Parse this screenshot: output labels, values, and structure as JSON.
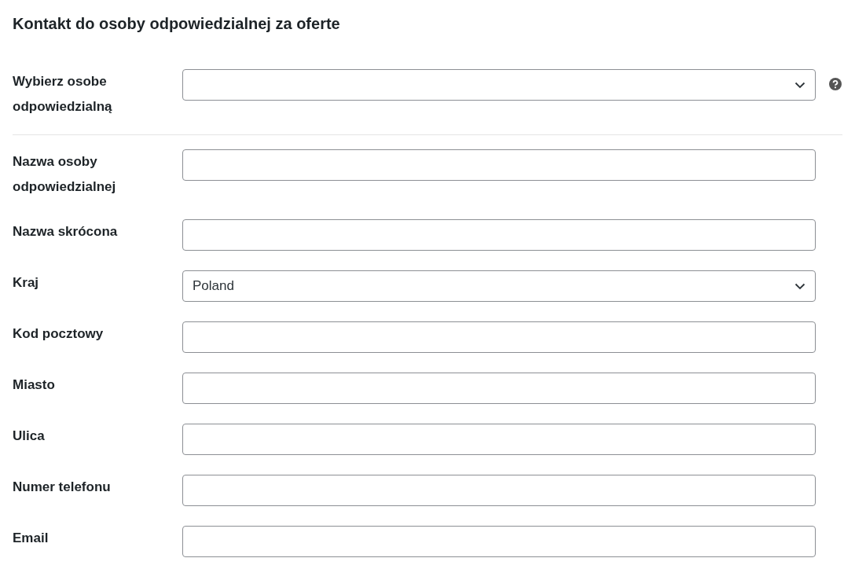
{
  "heading": "Kontakt do osoby odpowiedzialnej za oferte",
  "sections": [
    {
      "fields": [
        {
          "label": "Wybierz osobe odpowiedzialną",
          "kind": "select",
          "help": true
        }
      ]
    },
    {
      "fields": [
        {
          "label": "Nazwa osoby odpowiedzialnej",
          "kind": "text",
          "help": false
        },
        {
          "label": "Nazwa skrócona",
          "kind": "text",
          "help": false
        },
        {
          "label": "Kraj",
          "kind": "select",
          "value": "Poland",
          "help": false
        },
        {
          "label": "Kod pocztowy",
          "kind": "text",
          "help": false
        },
        {
          "label": "Miasto",
          "kind": "text",
          "help": false
        },
        {
          "label": "Ulica",
          "kind": "text",
          "help": false
        },
        {
          "label": "Numer telefonu",
          "kind": "text",
          "help": false
        },
        {
          "label": "Email",
          "kind": "text",
          "help": false
        }
      ]
    }
  ]
}
